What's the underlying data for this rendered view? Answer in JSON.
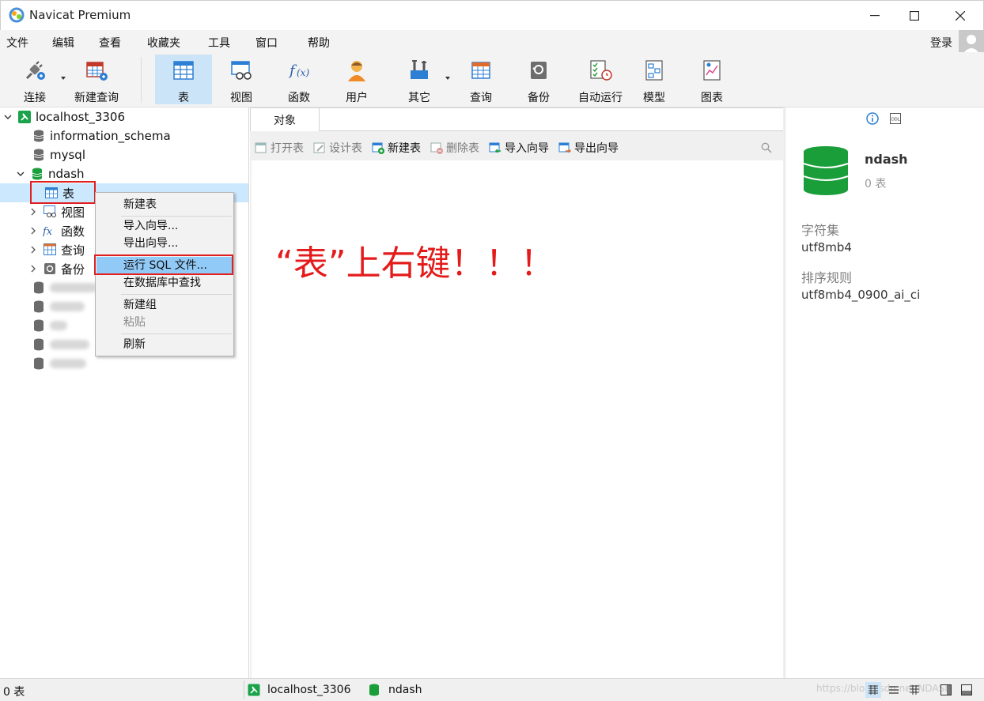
{
  "window": {
    "title": "Navicat Premium",
    "logo_icon": "navicat-logo-icon"
  },
  "menubar": {
    "items": [
      "文件",
      "编辑",
      "查看",
      "收藏夹",
      "工具",
      "窗口",
      "帮助"
    ],
    "login": "登录"
  },
  "toolbar": {
    "connect": "连接",
    "new_query": "新建查询",
    "table": "表",
    "view": "视图",
    "function": "函数",
    "user": "用户",
    "other": "其它",
    "query": "查询",
    "backup": "备份",
    "automation": "自动运行",
    "model": "模型",
    "chart": "图表"
  },
  "tree": {
    "connection": "localhost_3306",
    "db1": "information_schema",
    "db2": "mysql",
    "db3": "ndash",
    "node_table": "表",
    "node_view": "视图",
    "node_function": "函数",
    "node_query": "查询",
    "node_backup": "备份"
  },
  "context_menu": {
    "new_table": "新建表",
    "import_wizard": "导入向导...",
    "export_wizard": "导出向导...",
    "run_sql": "运行 SQL 文件...",
    "find_in_db": "在数据库中查找",
    "new_group": "新建组",
    "paste": "粘贴",
    "refresh": "刷新"
  },
  "center": {
    "tab_objects": "对象",
    "toolbar": {
      "open_table": "打开表",
      "design_table": "设计表",
      "new_table": "新建表",
      "delete_table": "删除表",
      "import_wizard": "导入向导",
      "export_wizard": "导出向导"
    },
    "annotation": "“表”上右键！！！"
  },
  "right_panel": {
    "db_name": "ndash",
    "table_count": "0 表",
    "charset_label": "字符集",
    "charset_value": "utf8mb4",
    "collation_label": "排序规则",
    "collation_value": "utf8mb4_0900_ai_ci"
  },
  "statusbar": {
    "count": "0 表",
    "connection": "localhost_3306",
    "database": "ndash",
    "watermark": "https://blog.csdn.net/NDASH"
  },
  "colors": {
    "accent_blue": "#cce4f7",
    "selection": "#cce8ff",
    "menu_highlight": "#91c9f7",
    "annotation_red": "#e41b1b",
    "db_green": "#1a9e3a"
  }
}
